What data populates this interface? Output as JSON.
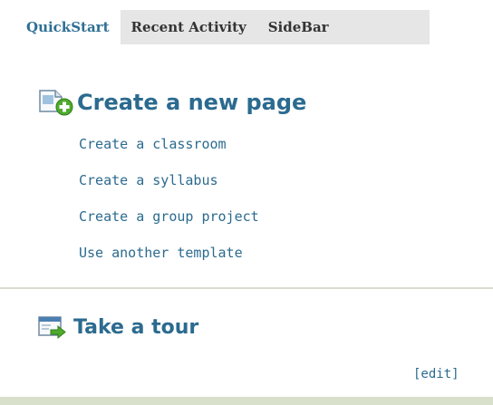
{
  "tabs": [
    {
      "label": "QuickStart",
      "active": true
    },
    {
      "label": "Recent Activity",
      "active": false
    },
    {
      "label": "SideBar",
      "active": false
    }
  ],
  "create_section": {
    "heading": "Create a new page",
    "icon": "new-page-icon",
    "links": [
      "Create a classroom",
      "Create a syllabus",
      "Create a group project",
      "Use another template"
    ]
  },
  "tour_section": {
    "heading": "Take a tour",
    "icon": "tour-page-icon"
  },
  "edit_link": "[edit]",
  "colors": {
    "link": "#2b6b8f",
    "active_tab": "#2e6f95",
    "tab_bar": "#e6e6e6",
    "divider": "#d8ddd0",
    "footer": "#d8e0cc"
  }
}
